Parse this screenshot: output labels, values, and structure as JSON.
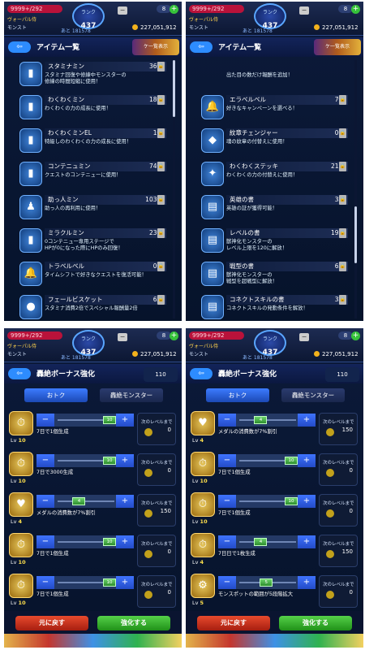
{
  "status": {
    "hp": "9999+/292",
    "stamina": "ヴォーパル侍",
    "monster_label": "モンスト",
    "rank_label": "ランク",
    "rank": "437",
    "exp": "あと 181578",
    "coins": "227,051,912",
    "gems": "8",
    "minus": "−",
    "plus": "+"
  },
  "panels": [
    {
      "title": "アイテム一覧",
      "back": "⇦",
      "badge": "ケ一覧表示",
      "items": [
        {
          "icon": "bottle-icon",
          "name": "スタミナミン",
          "count": "36個",
          "desc": [
            "スタミナ回復や修練中モンスターの",
            "修練の時間短縮に使用！"
          ]
        },
        {
          "icon": "bottle-icon",
          "name": "わくわくミン",
          "count": "18個",
          "desc": [
            "わくわくの力の成長に使用！"
          ]
        },
        {
          "icon": "bottle-icon",
          "name": "わくわくミンEL",
          "count": "1個",
          "desc": [
            "特級しのわくわくの力の成長に使用！"
          ]
        },
        {
          "icon": "bottle-icon",
          "name": "コンテニュミン",
          "count": "74個",
          "desc": [
            "クエストのコンテニューに使用！"
          ]
        },
        {
          "icon": "person-icon",
          "name": "助っ人ミン",
          "count": "103個",
          "desc": [
            "助っ人の再利用に使用！"
          ]
        },
        {
          "icon": "bottle-icon",
          "name": "ミラクルミン",
          "count": "23個",
          "desc": [
            "0コンテニュー専用ステージで",
            "HPが0になった際にHPのみ回復！"
          ]
        },
        {
          "icon": "bell-icon",
          "name": "トラベルベル",
          "count": "0個",
          "desc": [
            "タイムシフトで好きなクエストを復活可能！"
          ]
        },
        {
          "icon": "biscuit-icon",
          "name": "フェールビスケット",
          "count": "6枚",
          "desc": [
            "スタミナ消費2倍でスペシャル報酬量2倍"
          ]
        }
      ]
    },
    {
      "title": "アイテム一覧",
      "back": "⇦",
      "badge": "ケ一覧表示",
      "items": [
        {
          "icon": "",
          "name": "",
          "count": "",
          "desc": [
            "出た目の数だけ報酬を追加！"
          ]
        },
        {
          "icon": "bell-icon",
          "name": "エラベルベル",
          "count": "7個",
          "desc": [
            "好きなキャンペーンを選べる！"
          ]
        },
        {
          "icon": "badge-icon",
          "name": "紋章チェンジャー",
          "count": "0個",
          "desc": [
            "魂の紋章の付替えに使用！"
          ]
        },
        {
          "icon": "staff-icon",
          "name": "わくわくステッキ",
          "count": "21本",
          "desc": [
            "わくわくの力の付替えに使用！"
          ]
        },
        {
          "icon": "book-icon",
          "name": "英雄の書",
          "count": "3枚",
          "desc": [
            "英雄の証が獲得可能！"
          ]
        },
        {
          "icon": "book-icon",
          "name": "レベルの書",
          "count": "19枚",
          "desc": [
            "獣神化モンスターの",
            "レベル上限を120に解放！"
          ]
        },
        {
          "icon": "book-icon",
          "name": "戦型の書",
          "count": "6枚",
          "desc": [
            "獣神化モンスターの",
            "戦型を超戦型に解放！"
          ]
        },
        {
          "icon": "book-icon",
          "name": "コネクトスキルの書",
          "count": "3枚",
          "desc": [
            "コネクトスキルの発動条件を解放！"
          ]
        }
      ]
    },
    {
      "title": "轟絶ボーナス強化",
      "back": "⇦",
      "stam": "110",
      "tab_a": "おトク",
      "tab_b": "轟絶モンスター",
      "btn_back": "元に戻す",
      "btn_ok": "強化する",
      "rows": [
        {
          "icon": "clock-icon",
          "lv": "10",
          "knob": "10",
          "val": "",
          "eff": [
            "7日で1個生成",
            ""
          ],
          "nxt": "次のレベルまで",
          "nv": "0",
          "pos": 1.0
        },
        {
          "icon": "clock-icon",
          "lv": "10",
          "knob": "10",
          "val": "",
          "eff": [
            "7日で3000生成",
            ""
          ],
          "nxt": "次のレベルまで",
          "nv": "0",
          "pos": 1.0
        },
        {
          "icon": "heart-icon",
          "lv": "4",
          "knob": "4",
          "val": "",
          "eff": [
            "メダルの消費数が7%割引",
            ""
          ],
          "nxt": "次のレベルまで",
          "nv": "150",
          "pos": 0.33
        },
        {
          "icon": "clock-icon",
          "lv": "10",
          "knob": "10",
          "val": "",
          "eff": [
            "7日で1個生成",
            ""
          ],
          "nxt": "次のレベルまで",
          "nv": "0",
          "pos": 1.0
        },
        {
          "icon": "clock-icon",
          "lv": "10",
          "knob": "10",
          "val": "",
          "eff": [
            "7日で1個生成",
            ""
          ],
          "nxt": "次のレベルまで",
          "nv": "0",
          "pos": 1.0
        }
      ]
    },
    {
      "title": "轟絶ボーナス強化",
      "back": "⇦",
      "stam": "110",
      "tab_a": "おトク",
      "tab_b": "轟絶モンスター",
      "btn_back": "元に戻す",
      "btn_ok": "強化する",
      "rows": [
        {
          "icon": "heart-icon",
          "lv": "4",
          "knob": "4",
          "val": "",
          "eff": [
            "メダルの消費数が7%割引",
            ""
          ],
          "nxt": "次のレベルまで",
          "nv": "150",
          "pos": 0.33
        },
        {
          "icon": "clock-icon",
          "lv": "10",
          "knob": "10",
          "val": "",
          "eff": [
            "7日で1個生成",
            ""
          ],
          "nxt": "次のレベルまで",
          "nv": "0",
          "pos": 1.0
        },
        {
          "icon": "clock-icon",
          "lv": "10",
          "knob": "10",
          "val": "",
          "eff": [
            "7日で1個生成",
            ""
          ],
          "nxt": "次のレベルまで",
          "nv": "0",
          "pos": 1.0
        },
        {
          "icon": "clock-icon",
          "lv": "4",
          "knob": "4",
          "val": "",
          "eff": [
            "7日日で1枚生成",
            ""
          ],
          "nxt": "次のレベルまで",
          "nv": "150",
          "pos": 0.33
        },
        {
          "icon": "robot-icon",
          "lv": "5",
          "knob": "5",
          "val": "",
          "eff": [
            "モンスポットの範囲が5段階拡大",
            ""
          ],
          "nxt": "次のレベルまで",
          "nv": "0",
          "pos": 0.45
        }
      ]
    }
  ]
}
